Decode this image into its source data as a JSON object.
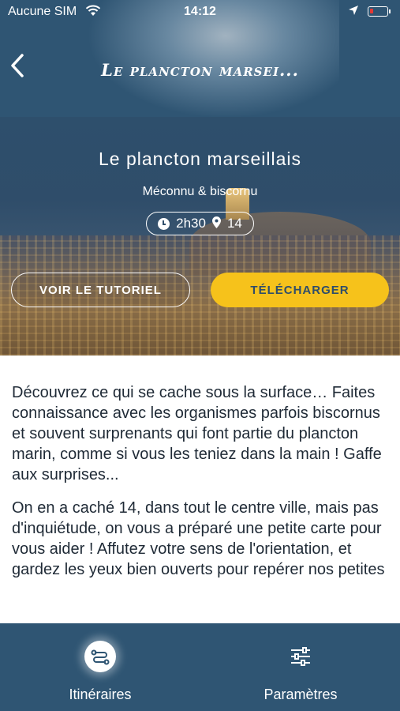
{
  "status_bar": {
    "carrier": "Aucune SIM",
    "time": "14:12",
    "battery_color": "#e53935"
  },
  "nav": {
    "title": "Le plancton marsei...",
    "back_icon": "chevron-left-icon"
  },
  "hero": {
    "title": "Le plancton marseillais",
    "subtitle": "Méconnu & biscornu",
    "duration": "2h30",
    "spots": "14",
    "tutorial_label": "VOIR LE TUTORIEL",
    "download_label": "TÉLÉCHARGER",
    "accent_color": "#f6c21b"
  },
  "description": {
    "paragraph_1": "Découvrez ce qui se cache sous la surface… Faites connaissance avec les organismes parfois biscornus et souvent surprenants qui font partie du plancton marin, comme si vous les teniez dans la main ! Gaffe aux surprises...",
    "paragraph_2": "On en a caché 14, dans tout le centre ville, mais pas d'inquiétude, on vous a préparé une petite carte pour vous aider ! Affutez votre sens de l'orientation, et gardez les yeux bien ouverts pour repérer nos petites"
  },
  "tabbar": {
    "background": "#2f5573",
    "tabs": [
      {
        "label": "Itinéraires",
        "icon": "route-icon",
        "active": true
      },
      {
        "label": "Paramètres",
        "icon": "sliders-icon",
        "active": false
      }
    ]
  }
}
